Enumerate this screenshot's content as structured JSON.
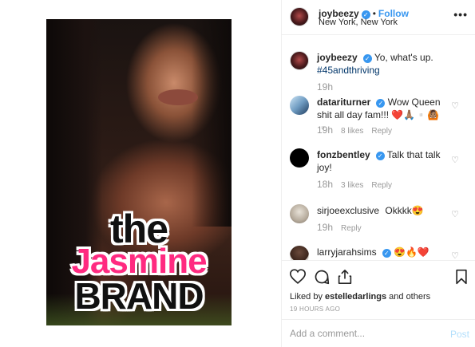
{
  "post": {
    "watermark": {
      "line1": "the",
      "line2": "Jasmine",
      "line3": "BRAND"
    }
  },
  "header": {
    "username": "joybeezy",
    "dot": "•",
    "follow_label": "Follow",
    "location": "New York, New York",
    "more_label": "•••"
  },
  "comments": [
    {
      "username": "joybeezy",
      "text": "Yo, what's up.",
      "hashtag": "#45andthriving",
      "time": "19h",
      "likes": "",
      "reply": ""
    },
    {
      "username": "datariturner",
      "text": "Wow Queen shit all day fam!!! ❤️🙏🏽▫️🙆🏽▫️",
      "time": "19h",
      "likes": "8 likes",
      "reply": "Reply"
    },
    {
      "username": "fonzbentley",
      "text": "Talk that talk joy!",
      "time": "18h",
      "likes": "3 likes",
      "reply": "Reply"
    },
    {
      "username": "sirjoeexclusive",
      "text": "Okkkk😍",
      "time": "19h",
      "likes": "",
      "reply": "Reply"
    },
    {
      "username": "larryjarahsims",
      "text": "😍🔥❤️"
    }
  ],
  "actions": {
    "liked_prefix": "Liked by",
    "liked_user": "estelledarlings",
    "liked_suffix": "and others",
    "time_ago": "19 HOURS AGO"
  },
  "add_comment": {
    "placeholder": "Add a comment...",
    "post_label": "Post"
  },
  "colors": {
    "accent": "#3897f0",
    "watermark_pink": "#ff2a80",
    "post_disabled": "#b2dffc"
  }
}
